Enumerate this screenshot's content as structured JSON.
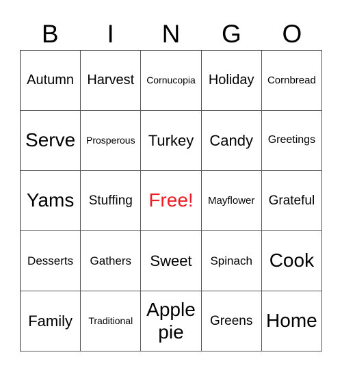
{
  "header": [
    "B",
    "I",
    "N",
    "G",
    "O"
  ],
  "free_color": "#ee1c25",
  "cells": [
    [
      "Autumn",
      "Harvest",
      "Cornucopia",
      "Holiday",
      "Cornbread"
    ],
    [
      "Serve",
      "Prosperous",
      "Turkey",
      "Candy",
      "Greetings"
    ],
    [
      "Yams",
      "Stuffing",
      "Free!",
      "Mayflower",
      "Grateful"
    ],
    [
      "Desserts",
      "Gathers",
      "Sweet",
      "Spinach",
      "Cook"
    ],
    [
      "Family",
      "Traditional",
      "Apple pie",
      "Greens",
      "Home"
    ]
  ]
}
